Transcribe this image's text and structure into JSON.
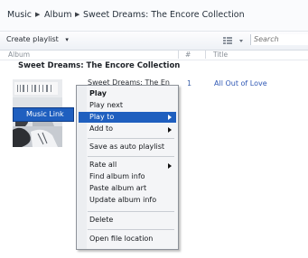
{
  "breadcrumb": {
    "items": [
      "Music",
      "Album",
      "Sweet Dreams: The Encore Collection"
    ]
  },
  "toolbar": {
    "create_playlist": "Create playlist",
    "dropdown_glyph": "▾",
    "search_placeholder": "Search"
  },
  "columns": {
    "album": "Album",
    "number": "#",
    "title": "Title"
  },
  "album": {
    "heading": "Sweet Dreams: The Encore Collection",
    "track_title": "Sweet Dreams: The En",
    "track_number": "1",
    "song_title": "All Out of Love"
  },
  "context_menu": {
    "items": [
      "Play",
      "Play next",
      "Play to",
      "Add to",
      "Save as auto playlist",
      "Rate all",
      "Find album info",
      "Paste album art",
      "Update album info",
      "Delete",
      "Open file location"
    ],
    "selected": "Play to",
    "submenu_item": "Music Link"
  },
  "colors": {
    "selection": "#1f5fbf",
    "link": "#2f58b5"
  }
}
